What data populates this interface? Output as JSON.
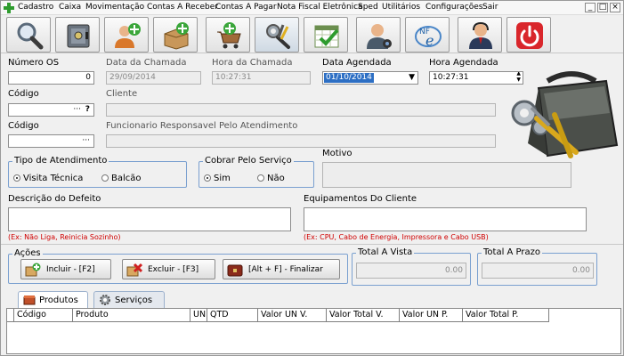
{
  "menu": [
    "Cadastro",
    "Caixa",
    "Movimentação",
    "Contas A Receber",
    "Contas A Pagar",
    "Nota Fiscal Eletrônica",
    "Sped",
    "Utilitários",
    "Configurações",
    "Sair"
  ],
  "window_controls": {
    "minimize": "_",
    "maximize": "□",
    "close": "×"
  },
  "form": {
    "numero_os_label": "Número OS",
    "numero_os_value": "0",
    "data_chamada_label": "Data da Chamada",
    "data_chamada_value": "29/09/2014",
    "hora_chamada_label": "Hora da Chamada",
    "hora_chamada_value": "10:27:31",
    "data_agendada_label": "Data Agendada",
    "data_agendada_value": "01/10/2014",
    "hora_agendada_label": "Hora Agendada",
    "hora_agendada_value": "10:27:31",
    "codigo_cliente_label": "Código",
    "cliente_label": "Cliente",
    "codigo_funcionario_label": "Código",
    "funcionario_label": "Funcionario Responsavel Pelo Atendimento",
    "lookup_dots": "···",
    "lookup_help": "?",
    "tipo_atendimento_label": "Tipo de Atendimento",
    "visita_label": "Visita Técnica",
    "balcao_label": "Balcão",
    "cobrar_label": "Cobrar Pelo Serviço",
    "sim_label": "Sim",
    "nao_label": "Não",
    "motivo_label": "Motivo",
    "descricao_label": "Descrição do Defeito",
    "descricao_hint": "(Ex: Não Liga, Reinicia Sozinho)",
    "equipamentos_label": "Equipamentos Do Cliente",
    "equipamentos_hint": "(Ex: CPU, Cabo de Energia, Impressora e Cabo USB)"
  },
  "acoes": {
    "title": "Ações",
    "incluir": "Incluir - [F2]",
    "excluir": "Excluir - [F3]",
    "finalizar": "[Alt + F] - Finalizar"
  },
  "totals": {
    "vista_label": "Total A Vista",
    "vista_value": "0.00",
    "prazo_label": "Total A Prazo",
    "prazo_value": "0.00"
  },
  "tabs": [
    "Produtos",
    "Serviços"
  ],
  "table": {
    "columns": [
      "Código",
      "Produto",
      "UN",
      "QTD",
      "Valor UN V.",
      "Valor Total V.",
      "Valor UN P.",
      "Valor Total P."
    ]
  },
  "colors": {
    "accent_blue": "#7aa0d0",
    "hint_red": "#d00000",
    "close_red": "#d9262b"
  },
  "icons": [
    "search-icon",
    "safe-icon",
    "add-user-icon",
    "add-box-icon",
    "add-cart-icon",
    "tools-icon",
    "calendar-check-icon",
    "user-webcam-icon",
    "nfe-icon",
    "support-agent-icon",
    "power-icon"
  ]
}
